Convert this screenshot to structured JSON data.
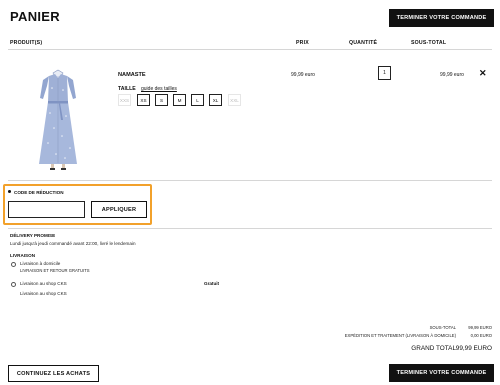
{
  "page_title": "PANIER",
  "top_checkout_label": "TERMINER VOTRE COMMANDE",
  "columns": {
    "product": "PRODUIT(S)",
    "price": "PRIX",
    "quantity": "QUANTITÉ",
    "subtotal": "SOUS-TOTAL"
  },
  "item": {
    "name": "NAMASTE",
    "size_label": "TAILLE",
    "size_guide": "guide des tailles",
    "sizes": [
      {
        "label": "XXS",
        "available": false
      },
      {
        "label": "XS",
        "available": true
      },
      {
        "label": "S",
        "available": true
      },
      {
        "label": "M",
        "available": true
      },
      {
        "label": "L",
        "available": true
      },
      {
        "label": "XL",
        "available": true
      },
      {
        "label": "XXL",
        "available": false
      }
    ],
    "price": "99,99 euro",
    "quantity": "1",
    "subtotal": "99,99 euro",
    "remove_glyph": "✕",
    "image_icon": "dress-image"
  },
  "discount": {
    "label": "CODE DE RÉDUCTION",
    "input_value": "",
    "apply_label": "APPLIQUER"
  },
  "delivery_promise": {
    "title": "DÉLIVERY PROMISE",
    "text": "Lundi jusqu'à jeudi commandé avant 22:00, livré le lendemain"
  },
  "shipping": {
    "title": "LIVRAISON",
    "option1_title": "Livraison à domicile",
    "option1_sub": "LIVRAISON ET RETOUR GRATUITS",
    "option2_title": "Livraison au shop CKS",
    "option2_price": "Gratuit",
    "option3_title": "Livraison au shop CKS"
  },
  "totals": {
    "subtotal_label": "SOUS-TOTAL",
    "subtotal_value": "99,99 EURO",
    "shipping_label": "EXPÉDITION ET TRAITEMENT (LIVRAISON À DOMICILE)",
    "shipping_value": "0,00 EURO",
    "grand_label": "GRAND TOTAL",
    "grand_value": "99,99 EURO"
  },
  "continue_label": "CONTINUEZ LES ACHATS",
  "bottom_checkout_label": "TERMINER VOTRE COMMANDE",
  "colors": {
    "accent": "#111111",
    "focus_outline": "#f2a12b",
    "dress": "#9fb0d6"
  }
}
